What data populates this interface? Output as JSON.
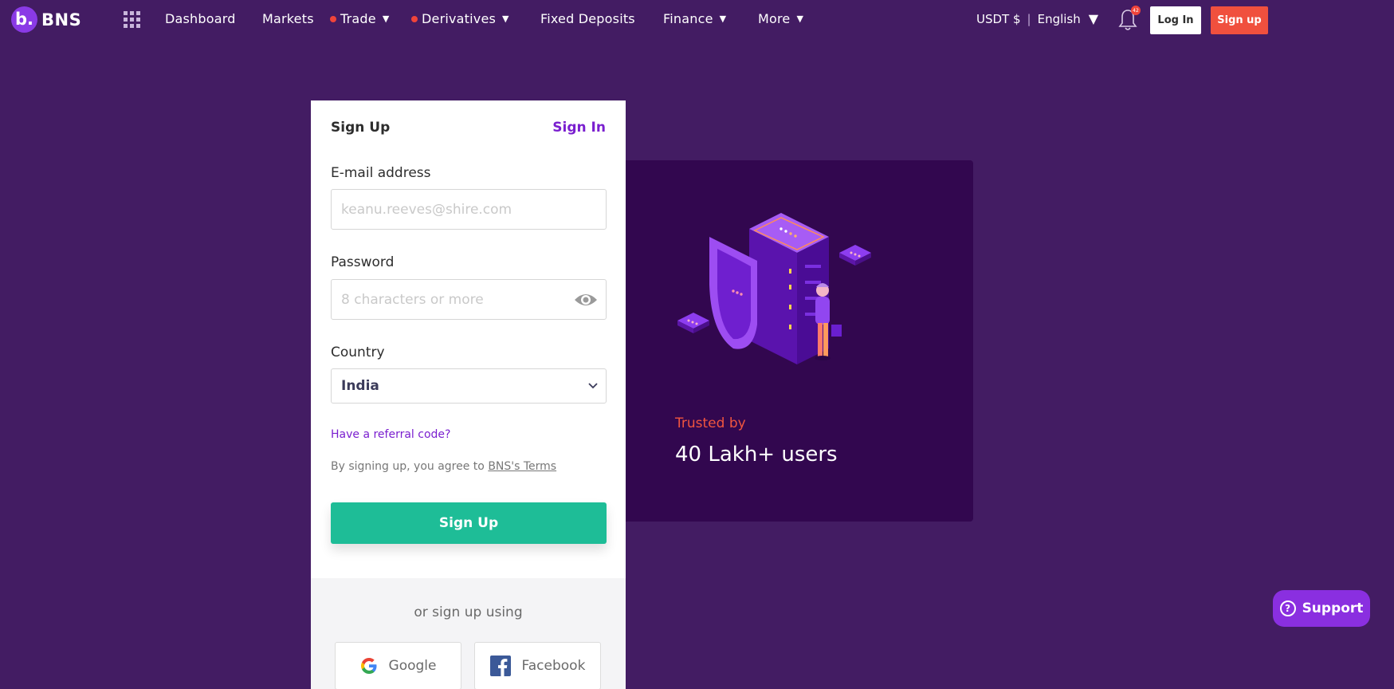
{
  "nav": {
    "logo_mark": "b.",
    "logo_text": "BNS",
    "apps_icon": "grid-icon",
    "items": [
      {
        "label": "Dashboard",
        "dot": false,
        "caret": false
      },
      {
        "label": "Markets",
        "dot": false,
        "caret": false
      },
      {
        "label": "Trade",
        "dot": true,
        "caret": true
      },
      {
        "label": "Derivatives",
        "dot": true,
        "caret": true
      },
      {
        "label": "Fixed Deposits",
        "dot": false,
        "caret": false
      },
      {
        "label": "Finance",
        "dot": false,
        "caret": true
      },
      {
        "label": "More",
        "dot": false,
        "caret": true
      }
    ],
    "currency": "USDT $",
    "separator": "|",
    "language": "English",
    "notification_count": "42",
    "login_label": "Log In",
    "signup_label": "Sign up"
  },
  "hero": {
    "trusted_label": "Trusted by",
    "users_text": "40 Lakh+ users"
  },
  "form": {
    "title": "Sign Up",
    "signin_link": "Sign In",
    "email_label": "E-mail address",
    "email_placeholder": "keanu.reeves@shire.com",
    "password_label": "Password",
    "password_placeholder": "8 characters or more",
    "country_label": "Country",
    "country_value": "India",
    "referral_link": "Have a referral code?",
    "terms_prefix": "By signing up, you agree to ",
    "terms_link": "BNS's Terms",
    "submit_label": "Sign Up",
    "alt_text": "or sign up using",
    "google_label": "Google",
    "facebook_label": "Facebook"
  },
  "support": {
    "label": "Support"
  },
  "colors": {
    "background": "#431c63",
    "hero_panel": "#32074f",
    "accent_purple": "#7a1fcf",
    "signup_red": "#f0503e",
    "submit_green": "#1ebd97"
  }
}
